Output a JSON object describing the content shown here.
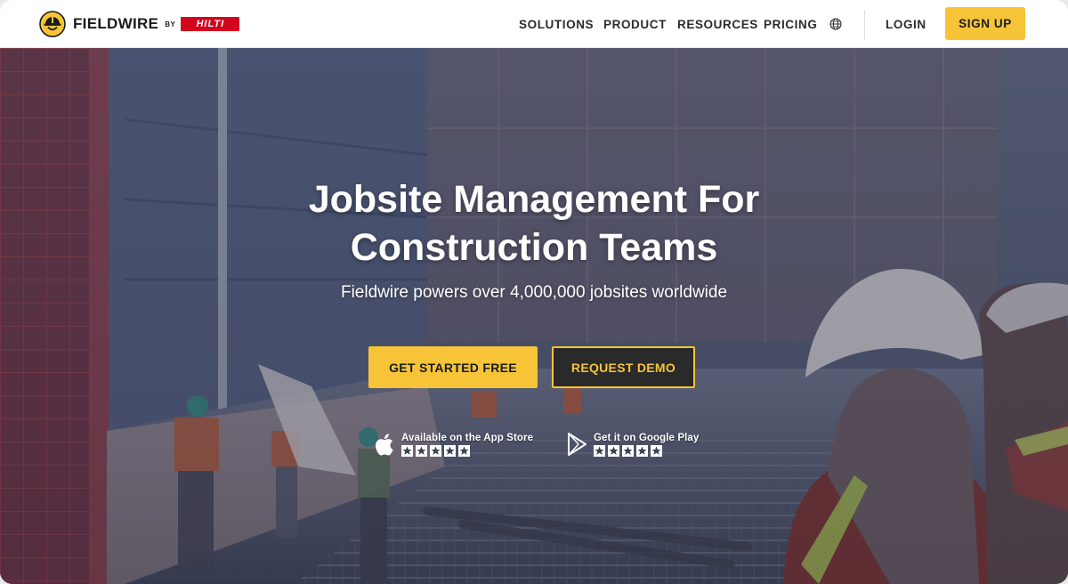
{
  "brand": {
    "name": "FIELDWIRE",
    "by": "BY",
    "partner": "HILTI"
  },
  "nav": {
    "items": [
      {
        "label": "SOLUTIONS"
      },
      {
        "label": "PRODUCT"
      },
      {
        "label": "RESOURCES"
      },
      {
        "label": "PRICING"
      }
    ],
    "login_label": "LOGIN",
    "signup_label": "SIGN UP"
  },
  "hero": {
    "title_line1": "Jobsite Management For",
    "title_line2": "Construction Teams",
    "subtitle": "Fieldwire powers over 4,000,000 jobsites worldwide",
    "cta_primary": "GET STARTED FREE",
    "cta_secondary": "REQUEST DEMO",
    "app_store": {
      "label": "Available on the App Store",
      "rating_stars": 5
    },
    "google_play": {
      "label": "Get it on Google Play",
      "rating_stars": 5
    }
  },
  "colors": {
    "accent_yellow": "#f6c436",
    "hilti_red": "#d2051e",
    "text_dark": "#1b1b1b"
  },
  "icons": {
    "logo": "hardhat-worker-icon",
    "language": "globe-icon",
    "apple": "apple-icon",
    "google_play": "google-play-icon",
    "rating": "star-icon"
  }
}
